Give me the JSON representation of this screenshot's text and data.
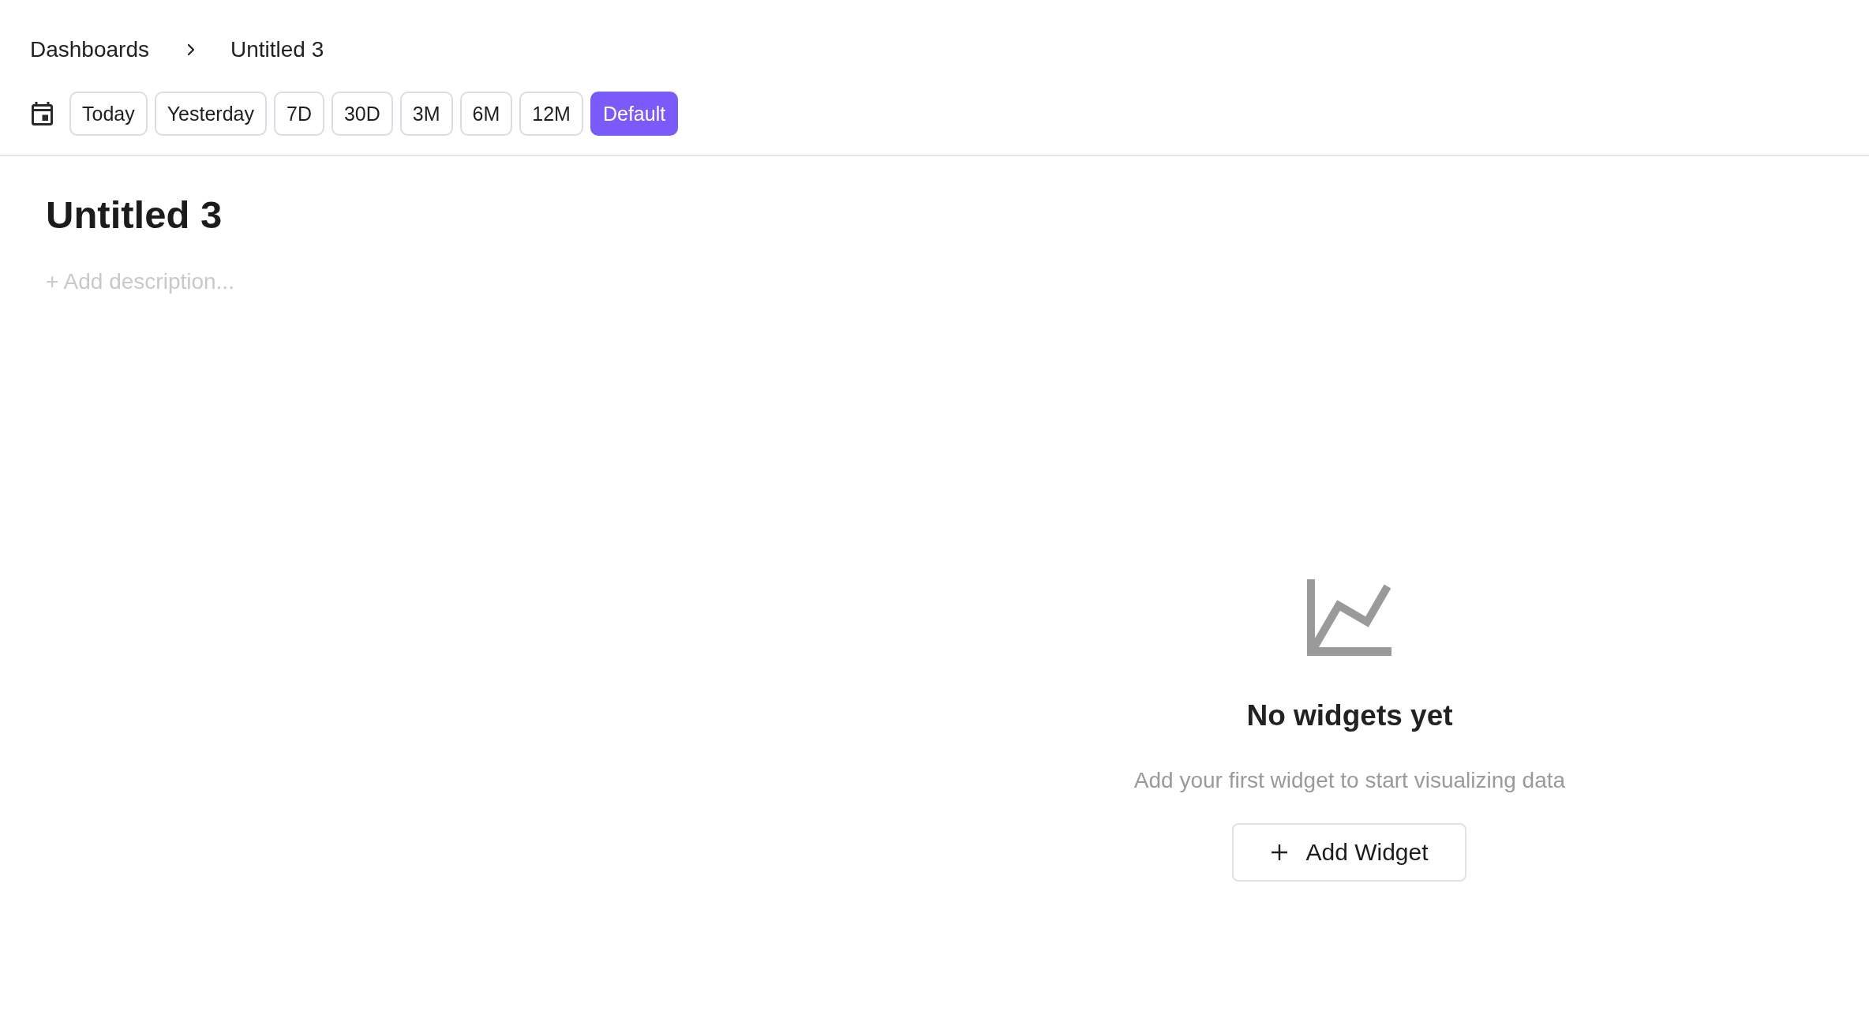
{
  "breadcrumb": [
    {
      "label": "Dashboards"
    },
    {
      "label": "Untitled 3"
    }
  ],
  "date_ranges": [
    {
      "label": "Today",
      "selected": false
    },
    {
      "label": "Yesterday",
      "selected": false
    },
    {
      "label": "7D",
      "selected": false
    },
    {
      "label": "30D",
      "selected": false
    },
    {
      "label": "3M",
      "selected": false
    },
    {
      "label": "6M",
      "selected": false
    },
    {
      "label": "12M",
      "selected": false
    },
    {
      "label": "Default",
      "selected": true
    }
  ],
  "dashboard": {
    "title": "Untitled 3",
    "add_description": "+ Add description..."
  },
  "empty_state": {
    "title": "No widgets yet",
    "message": "Add your first widget to start visualizing data",
    "button": {
      "label": "Add Widget"
    }
  }
}
